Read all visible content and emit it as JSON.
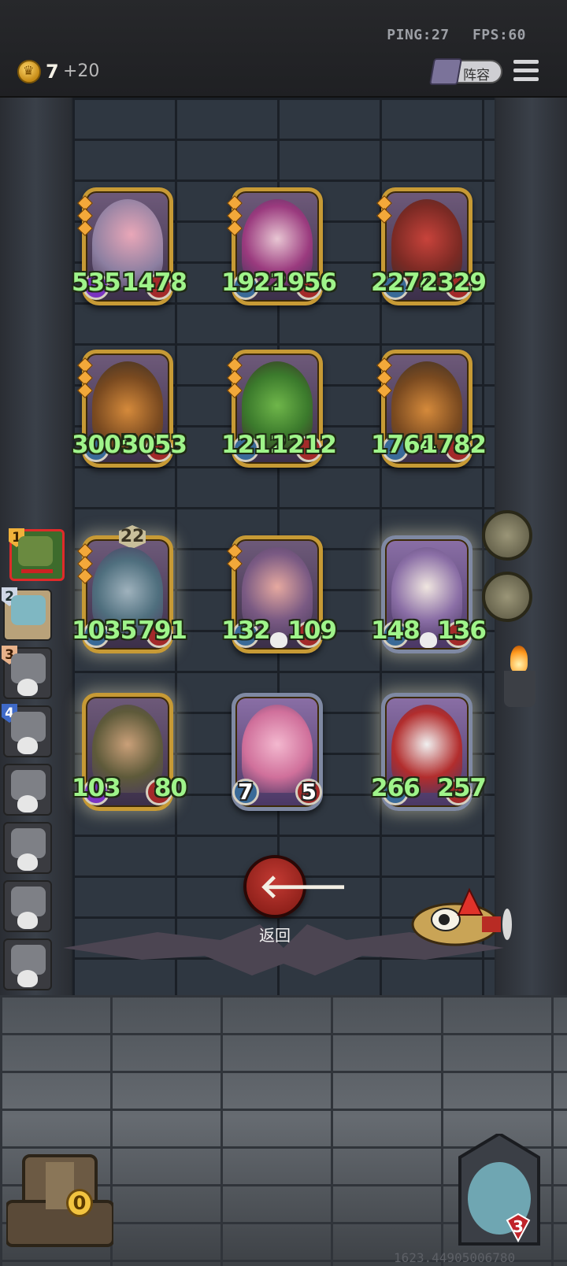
{
  "status": {
    "ping": "PING:27",
    "fps": "FPS:60"
  },
  "currency": {
    "amount": "7",
    "bonus": "+20"
  },
  "header": {
    "lineup_label": "阵容"
  },
  "enemy_board": [
    {
      "atk": "535",
      "hp": "1478"
    },
    {
      "atk": "1922",
      "hp": "1956"
    },
    {
      "atk": "2274",
      "hp": "2329"
    },
    {
      "atk": "3005",
      "hp": "3053"
    },
    {
      "atk": "1212",
      "hp": "1212"
    },
    {
      "atk": "1764",
      "hp": "1782"
    }
  ],
  "player_board": [
    {
      "atk": "1035",
      "hp": "791",
      "level": "22"
    },
    {
      "atk": "132",
      "hp": "109"
    },
    {
      "atk": "148",
      "hp": "136"
    },
    {
      "atk": "103",
      "hp": "80"
    },
    {
      "atk": "7",
      "hp": "5"
    },
    {
      "atk": "266",
      "hp": "257"
    }
  ],
  "roster": [
    "1",
    "2",
    "3",
    "4"
  ],
  "back_button": {
    "label": "返回"
  },
  "chest": {
    "count": "0"
  },
  "boss": {
    "lives": "3"
  },
  "debug_text": "1623.44905006780"
}
